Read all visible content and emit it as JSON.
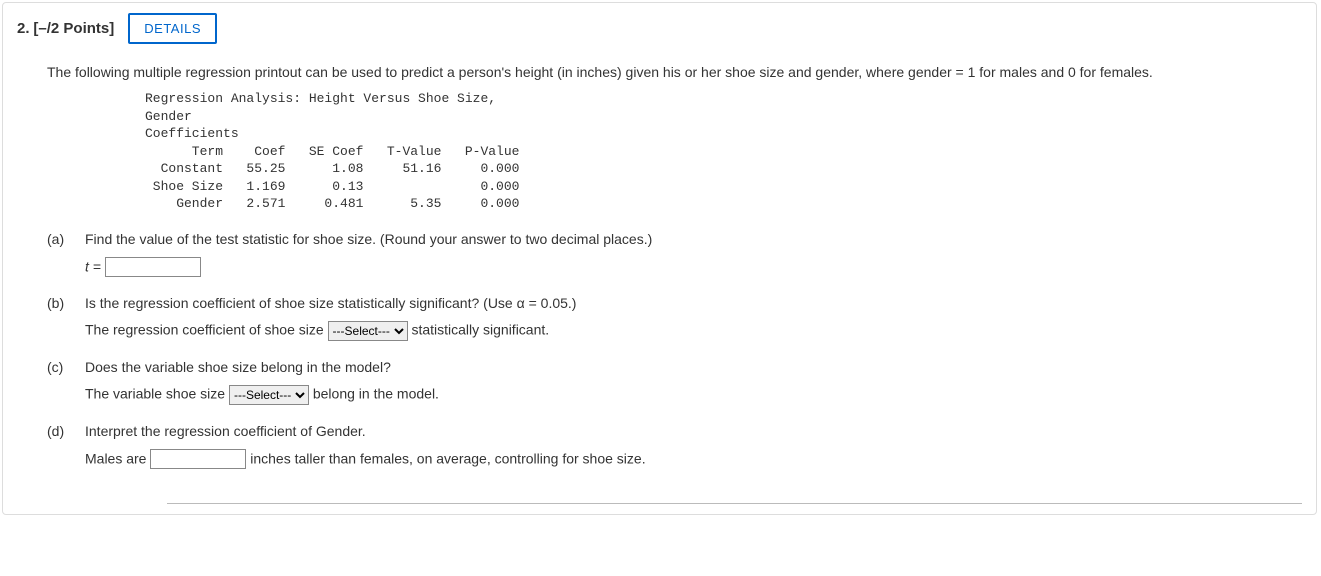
{
  "header": {
    "number_label": "2.",
    "points_label": "[–/2 Points]",
    "details_label": "DETAILS"
  },
  "intro": "The following multiple regression printout can be used to predict a person's height (in inches) given his or her shoe size and gender, where gender = 1 for males and 0 for females.",
  "printout": {
    "title": "Regression Analysis: Height Versus Shoe Size,\nGender",
    "section": "Coefficients",
    "headers": {
      "term": "Term",
      "coef": "Coef",
      "se": "SE Coef",
      "t": "T-Value",
      "p": "P-Value"
    },
    "rows": [
      {
        "term": "Constant",
        "coef": "55.25",
        "se": "1.08",
        "t": "51.16",
        "p": "0.000"
      },
      {
        "term": "Shoe Size",
        "coef": "1.169",
        "se": "0.13",
        "t": "",
        "p": "0.000"
      },
      {
        "term": "Gender",
        "coef": "2.571",
        "se": "0.481",
        "t": "5.35",
        "p": "0.000"
      }
    ]
  },
  "parts": {
    "a": {
      "label": "(a)",
      "prompt": "Find the value of the test statistic for shoe size. (Round your answer to two decimal places.)",
      "answer_prefix": "t ="
    },
    "b": {
      "label": "(b)",
      "prompt": "Is the regression coefficient of shoe size statistically significant? (Use α = 0.05.)",
      "answer_before": "The regression coefficient of shoe size",
      "select_placeholder": "---Select---",
      "answer_after": "statistically significant."
    },
    "c": {
      "label": "(c)",
      "prompt": "Does the variable shoe size belong in the model?",
      "answer_before": "The variable shoe size",
      "select_placeholder": "---Select---",
      "answer_after": "belong in the model."
    },
    "d": {
      "label": "(d)",
      "prompt": "Interpret the regression coefficient of Gender.",
      "answer_before": "Males are",
      "answer_after": "inches taller than females, on average, controlling for shoe size."
    }
  }
}
